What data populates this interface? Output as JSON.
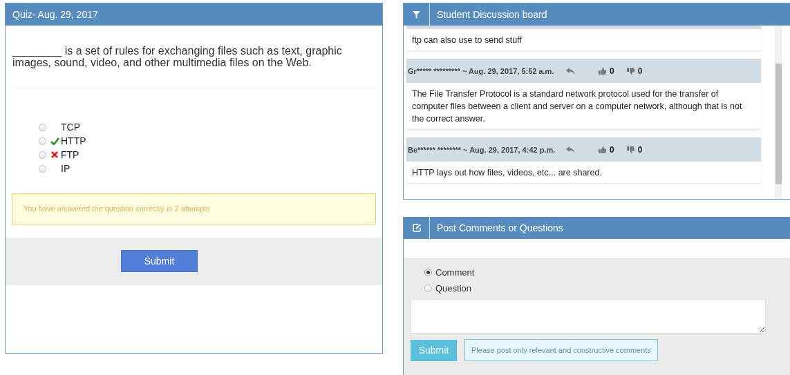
{
  "quiz": {
    "title": "Quiz- Aug. 29, 2017",
    "question": "________ is a set of rules for exchanging files such as text, graphic images, sound, video, and other multimedia files on the Web.",
    "options": [
      {
        "label": "TCP",
        "selected": false,
        "kind": "plain"
      },
      {
        "label": "HTTP",
        "selected": false,
        "kind": "correct"
      },
      {
        "label": "FTP",
        "selected": false,
        "kind": "wrong"
      },
      {
        "label": "IP",
        "selected": false,
        "kind": "plain"
      }
    ],
    "notice": "You have answered the question correctly in 2 attempts",
    "submit": "Submit"
  },
  "discussion": {
    "title": "Student Discussion board",
    "posts": [
      {
        "body": "ftp can also use to send stuff"
      },
      {
        "author": "Gr***** *********",
        "date": "~ Aug. 29, 2017, 5:52 a.m.",
        "likes": "0",
        "dislikes": "0",
        "body": "The File Transfer Protocol is a standard network protocol used for the transfer of computer files between a client and server on a computer network, although that is not the correct answer."
      },
      {
        "author": "Be****** ********",
        "date": "~ Aug. 29, 2017, 4:42 p.m.",
        "likes": "0",
        "dislikes": "0",
        "body": "HTTP lays out how files, videos, etc... are shared."
      }
    ]
  },
  "post_form": {
    "title": "Post Comments or Questions",
    "types": [
      {
        "label": "Comment",
        "selected": true
      },
      {
        "label": "Question",
        "selected": false
      }
    ],
    "submit": "Submit",
    "hint": "Please post only relevant and constructive comments"
  }
}
